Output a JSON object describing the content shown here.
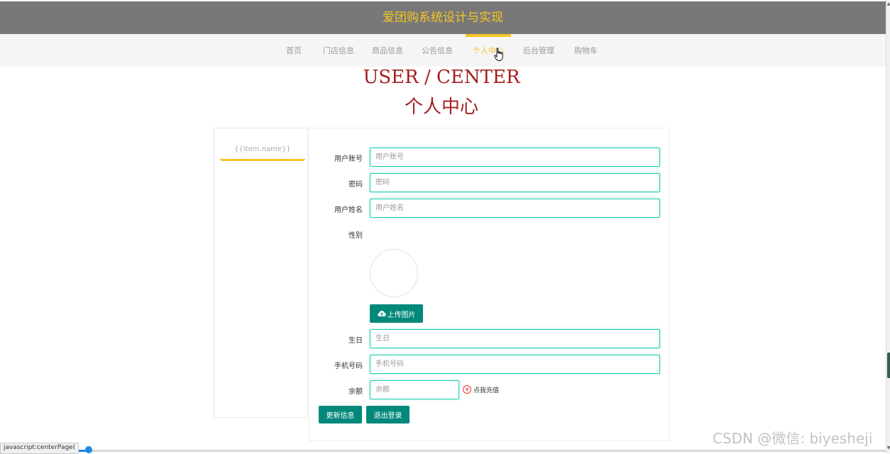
{
  "header": {
    "title": "爱团购系统设计与实现"
  },
  "nav": {
    "items": [
      {
        "label": "首页"
      },
      {
        "label": "门店信息"
      },
      {
        "label": "商品信息"
      },
      {
        "label": "公告信息"
      },
      {
        "label": "个人中心"
      },
      {
        "label": "后台管理"
      },
      {
        "label": "购物车"
      }
    ],
    "active": "个人中心"
  },
  "page": {
    "heading_en": "USER / CENTER",
    "heading_cn": "个人中心"
  },
  "sidebar": {
    "items": [
      {
        "label": "{{item.name}}"
      }
    ]
  },
  "form": {
    "fields": {
      "username": {
        "label": "用户账号",
        "placeholder": "用户账号",
        "value": ""
      },
      "password": {
        "label": "密码",
        "placeholder": "密码",
        "value": ""
      },
      "realname": {
        "label": "用户姓名",
        "placeholder": "用户姓名",
        "value": ""
      },
      "gender": {
        "label": "性别"
      },
      "birthday": {
        "label": "生日",
        "placeholder": "生日",
        "value": ""
      },
      "phone": {
        "label": "手机号码",
        "placeholder": "手机号码",
        "value": ""
      },
      "balance": {
        "label": "余额",
        "placeholder": "余额",
        "value": ""
      }
    },
    "upload_label": "上传图片",
    "recharge_label": "点我充值",
    "recharge_icon": "¥",
    "update_label": "更新信息",
    "logout_label": "退出登录"
  },
  "status_bar": {
    "url": "javascript:centerPage("
  },
  "watermark": "CSDN @微信: biyesheji",
  "colors": {
    "accent": "#f3c623",
    "header_bg": "#787878",
    "heading": "#a51d1d",
    "button": "#00897b",
    "input_border": "#1fcfae"
  },
  "icons": {
    "upload": "cloud-upload-icon",
    "recharge": "yen-circle-icon",
    "cursor": "hand-pointer-icon"
  }
}
